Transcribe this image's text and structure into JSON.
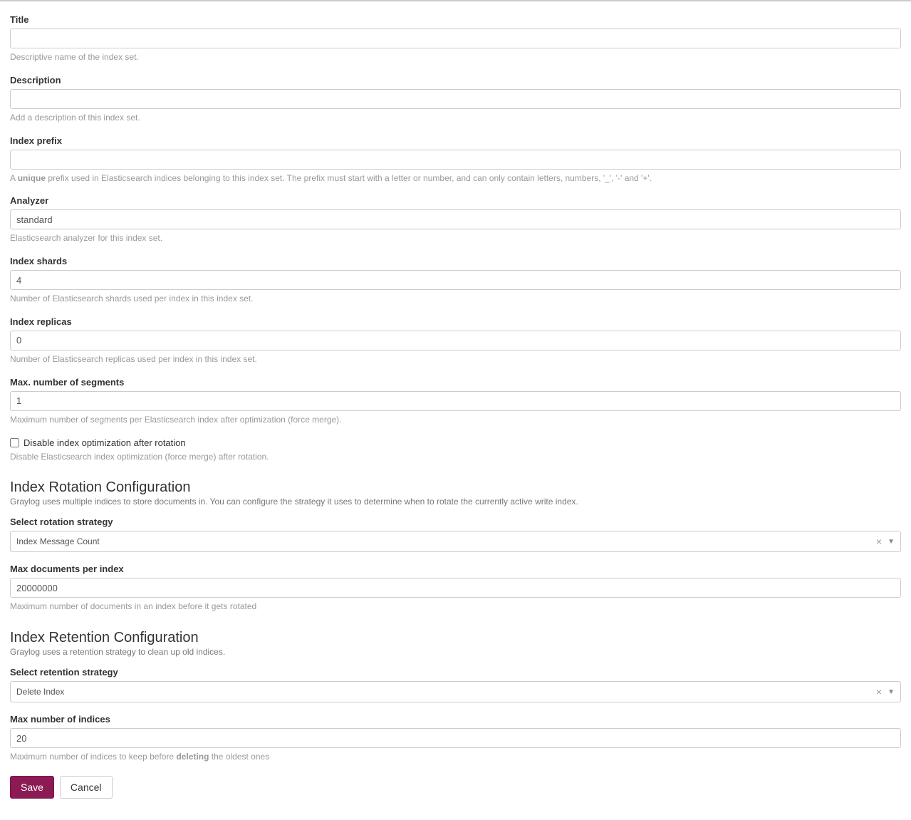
{
  "title": {
    "label": "Title",
    "value": "",
    "help": "Descriptive name of the index set."
  },
  "description": {
    "label": "Description",
    "value": "",
    "help": "Add a description of this index set."
  },
  "index_prefix": {
    "label": "Index prefix",
    "value": "",
    "help_prefix": "A ",
    "help_bold": "unique",
    "help_suffix": " prefix used in Elasticsearch indices belonging to this index set. The prefix must start with a letter or number, and can only contain letters, numbers, '_', '-' and '+'."
  },
  "analyzer": {
    "label": "Analyzer",
    "value": "standard",
    "help": "Elasticsearch analyzer for this index set."
  },
  "index_shards": {
    "label": "Index shards",
    "value": "4",
    "help": "Number of Elasticsearch shards used per index in this index set."
  },
  "index_replicas": {
    "label": "Index replicas",
    "value": "0",
    "help": "Number of Elasticsearch replicas used per index in this index set."
  },
  "max_segments": {
    "label": "Max. number of segments",
    "value": "1",
    "help": "Maximum number of segments per Elasticsearch index after optimization (force merge)."
  },
  "disable_opt": {
    "label": "Disable index optimization after rotation",
    "help": "Disable Elasticsearch index optimization (force merge) after rotation."
  },
  "rotation_section": {
    "heading": "Index Rotation Configuration",
    "desc": "Graylog uses multiple indices to store documents in. You can configure the strategy it uses to determine when to rotate the currently active write index."
  },
  "rotation_strategy": {
    "label": "Select rotation strategy",
    "value": "Index Message Count"
  },
  "max_docs": {
    "label": "Max documents per index",
    "value": "20000000",
    "help": "Maximum number of documents in an index before it gets rotated"
  },
  "retention_section": {
    "heading": "Index Retention Configuration",
    "desc": "Graylog uses a retention strategy to clean up old indices."
  },
  "retention_strategy": {
    "label": "Select retention strategy",
    "value": "Delete Index"
  },
  "max_indices": {
    "label": "Max number of indices",
    "value": "20",
    "help_prefix": "Maximum number of indices to keep before ",
    "help_bold": "deleting",
    "help_suffix": " the oldest ones"
  },
  "buttons": {
    "save": "Save",
    "cancel": "Cancel"
  }
}
